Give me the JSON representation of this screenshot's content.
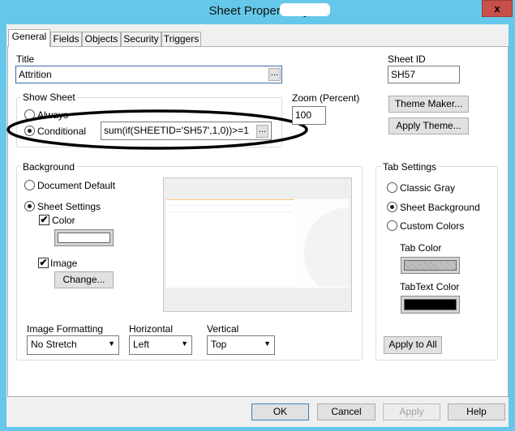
{
  "window": {
    "title": "Sheet Properties [",
    "close": "x"
  },
  "tabs": [
    "General",
    "Fields",
    "Objects",
    "Security",
    "Triggers"
  ],
  "general": {
    "title_label": "Title",
    "title_value": "Attrition",
    "ellipsis": "...",
    "sheet_id_label": "Sheet ID",
    "sheet_id_value": "SH57",
    "show_sheet": {
      "legend": "Show Sheet",
      "always": "Always",
      "conditional": "Conditional",
      "selected": "Conditional",
      "condition_value": "sum(if(SHEETID='SH57',1,0))>=1"
    },
    "zoom_label": "Zoom (Percent)",
    "zoom_value": "100",
    "theme_maker": "Theme Maker...",
    "apply_theme": "Apply Theme...",
    "background": {
      "legend": "Background",
      "document_default": "Document Default",
      "sheet_settings": "Sheet Settings",
      "selected": "Sheet Settings",
      "color_label": "Color",
      "color_checked": true,
      "color_value": "#ffffff",
      "image_label": "Image",
      "image_checked": true,
      "change_button": "Change...",
      "image_formatting_label": "Image Formatting",
      "image_formatting_value": "No Stretch",
      "horizontal_label": "Horizontal",
      "horizontal_value": "Left",
      "vertical_label": "Vertical",
      "vertical_value": "Top"
    },
    "tab_settings": {
      "legend": "Tab Settings",
      "classic_gray": "Classic Gray",
      "sheet_background": "Sheet Background",
      "custom_colors": "Custom Colors",
      "selected": "Sheet Background",
      "tab_color_label": "Tab Color",
      "tabtext_color_label": "TabText Color",
      "tabtext_color": "#000000",
      "apply_to_all": "Apply to All"
    }
  },
  "footer": {
    "ok": "OK",
    "cancel": "Cancel",
    "apply": "Apply",
    "help": "Help"
  }
}
